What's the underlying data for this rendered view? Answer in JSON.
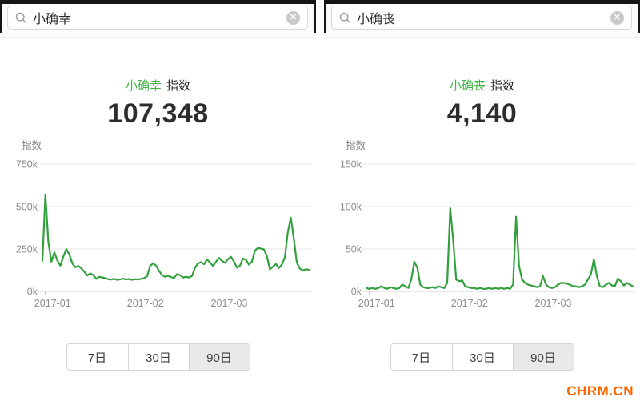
{
  "colors": {
    "line": "#32a03c",
    "keyword_green": "#44b549",
    "grid": "#e7e7e7",
    "axis": "#cfcfcf",
    "tick": "#bfbfbf",
    "axis_text": "#8d8d8d",
    "watermark": "#ff6600"
  },
  "watermark": {
    "text": "CHRM.CN"
  },
  "panels": [
    {
      "search": {
        "query": "小确幸",
        "clear_glyph": "✕"
      },
      "title": {
        "keyword": "小确幸",
        "suffix": "指数"
      },
      "index_value": "107,348",
      "range_buttons": [
        {
          "label": "7日",
          "selected": false
        },
        {
          "label": "30日",
          "selected": false
        },
        {
          "label": "90日",
          "selected": true
        }
      ],
      "chart_data": {
        "type": "line",
        "title": "小确幸 指数 90日趋势",
        "ylabel": "指数",
        "unit": "k",
        "ylim": [
          0,
          750
        ],
        "y_ticks": [
          {
            "label": "750k",
            "value": 750
          },
          {
            "label": "500k",
            "value": 500
          },
          {
            "label": "250k",
            "value": 250
          },
          {
            "label": "0k",
            "value": 0
          }
        ],
        "x_ticks": [
          {
            "label": "2017-01",
            "day": 1
          },
          {
            "label": "2017-02",
            "day": 32
          },
          {
            "label": "2017-03",
            "day": 60
          }
        ],
        "values_k": [
          180,
          570,
          290,
          175,
          230,
          182,
          152,
          205,
          250,
          218,
          165,
          142,
          150,
          136,
          116,
          94,
          106,
          96,
          74,
          86,
          82,
          78,
          72,
          70,
          74,
          68,
          71,
          75,
          70,
          73,
          68,
          72,
          70,
          74,
          78,
          90,
          150,
          165,
          152,
          120,
          96,
          86,
          92,
          84,
          80,
          102,
          96,
          82,
          86,
          82,
          92,
          140,
          165,
          172,
          160,
          188,
          170,
          150,
          175,
          198,
          180,
          168,
          190,
          204,
          176,
          140,
          152,
          194,
          186,
          158,
          176,
          240,
          256,
          252,
          248,
          208,
          130,
          146,
          162,
          138,
          158,
          200,
          350,
          435,
          310,
          170,
          135,
          124,
          130,
          128
        ]
      }
    },
    {
      "search": {
        "query": "小确丧",
        "clear_glyph": "✕"
      },
      "title": {
        "keyword": "小确丧",
        "suffix": "指数"
      },
      "index_value": "4,140",
      "range_buttons": [
        {
          "label": "7日",
          "selected": false
        },
        {
          "label": "30日",
          "selected": false
        },
        {
          "label": "90日",
          "selected": true
        }
      ],
      "chart_data": {
        "type": "line",
        "title": "小确丧 指数 90日趋势",
        "ylabel": "指数",
        "unit": "k",
        "ylim": [
          0,
          150
        ],
        "y_ticks": [
          {
            "label": "150k",
            "value": 150
          },
          {
            "label": "100k",
            "value": 100
          },
          {
            "label": "50k",
            "value": 50
          },
          {
            "label": "0k",
            "value": 0
          }
        ],
        "x_ticks": [
          {
            "label": "2017-01",
            "day": 1
          },
          {
            "label": "2017-02",
            "day": 32
          },
          {
            "label": "2017-03",
            "day": 60
          }
        ],
        "values_k": [
          4,
          3,
          4,
          3,
          4,
          6,
          4,
          3,
          5,
          4,
          3,
          4,
          8,
          6,
          4,
          14,
          35,
          28,
          8,
          5,
          4,
          4,
          5,
          4,
          6,
          5,
          4,
          10,
          98,
          60,
          14,
          12,
          13,
          6,
          5,
          4,
          4,
          3,
          4,
          3,
          3,
          4,
          3,
          4,
          3,
          4,
          3,
          4,
          3,
          8,
          88,
          30,
          14,
          10,
          8,
          7,
          6,
          5,
          6,
          18,
          8,
          5,
          4,
          5,
          8,
          10,
          10,
          9,
          8,
          6,
          6,
          5,
          6,
          8,
          14,
          20,
          38,
          18,
          6,
          5,
          8,
          10,
          7,
          6,
          15,
          12,
          7,
          10,
          8,
          6
        ]
      }
    }
  ]
}
